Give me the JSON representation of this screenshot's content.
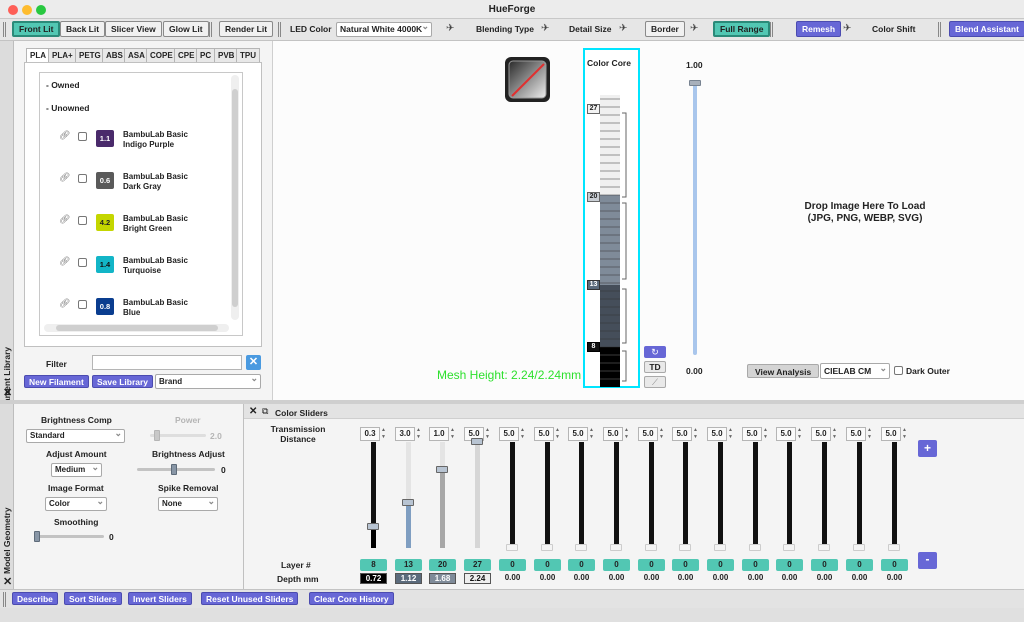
{
  "window": {
    "title": "HueForge"
  },
  "toolbar": {
    "front_lit": "Front Lit",
    "back_lit": "Back Lit",
    "slicer_view": "Slicer View",
    "glow_lit": "Glow Lit",
    "render_lit": "Render Lit",
    "led_color_label": "LED Color",
    "led_color_value": "Natural White 4000K",
    "blending_type": "Blending Type",
    "detail_size": "Detail Size",
    "border": "Border",
    "full_range": "Full Range",
    "remesh": "Remesh",
    "color_shift": "Color Shift",
    "blend_assistant": "Blend Assistant"
  },
  "library": {
    "side_label": "Filament Library",
    "tabs": [
      "PLA",
      "PLA+",
      "PETG",
      "ABS",
      "ASA",
      "COPE",
      "CPE",
      "PC",
      "PVB",
      "TPU"
    ],
    "owned": "- Owned",
    "unowned": "- Unowned",
    "filaments": [
      {
        "td": "1.1",
        "color": "#4a2a6b",
        "name": "BambuLab Basic",
        "variant": "Indigo Purple"
      },
      {
        "td": "0.6",
        "color": "#5a5a5a",
        "name": "BambuLab Basic",
        "variant": "Dark Gray"
      },
      {
        "td": "4.2",
        "color": "#c4d600",
        "name": "BambuLab Basic",
        "variant": "Bright Green"
      },
      {
        "td": "1.4",
        "color": "#12b5c7",
        "name": "BambuLab Basic",
        "variant": "Turquoise"
      },
      {
        "td": "0.8",
        "color": "#0a3d8f",
        "name": "BambuLab Basic",
        "variant": "Blue"
      }
    ],
    "filter_label": "Filter",
    "filter_value": "",
    "new_filament": "New Filament",
    "save_library": "Save Library",
    "sort_value": "Brand"
  },
  "viewer": {
    "color_core_title": "Color Core",
    "layer_markers": [
      "27",
      "20",
      "13",
      "8"
    ],
    "mesh_height": "Mesh Height: 2.24/2.24mm",
    "td_button": "TD",
    "scale_max": "1.00",
    "scale_min": "0.00",
    "drop_line1": "Drop Image Here To Load",
    "drop_line2": "(JPG, PNG, WEBP, SVG)",
    "view_analysis": "View Analysis",
    "analysis_mode": "CIELAB CM",
    "dark_outer": "Dark Outer"
  },
  "geometry": {
    "side_label": "Model Geometry",
    "brightness_comp": "Brightness Comp",
    "brightness_comp_value": "Standard",
    "power": "Power",
    "power_value": "2.0",
    "adjust_amount": "Adjust Amount",
    "adjust_amount_value": "Medium",
    "brightness_adjust": "Brightness Adjust",
    "brightness_adjust_value": "0",
    "image_format": "Image Format",
    "image_format_value": "Color",
    "spike_removal": "Spike Removal",
    "spike_removal_value": "None",
    "smoothing": "Smoothing",
    "smoothing_value": "0"
  },
  "sliders": {
    "title": "Color Sliders",
    "transmission_label1": "Transmission",
    "transmission_label2": "Distance",
    "layer_label": "Layer #",
    "depth_label": "Depth mm",
    "plus": "+",
    "minus": "-",
    "columns": [
      {
        "td": "0.3",
        "layer": "8",
        "depth": "0.72",
        "level": 0.2
      },
      {
        "td": "3.0",
        "layer": "13",
        "depth": "1.12",
        "level": 0.42
      },
      {
        "td": "1.0",
        "layer": "20",
        "depth": "1.68",
        "level": 0.74
      },
      {
        "td": "5.0",
        "layer": "27",
        "depth": "2.24",
        "level": 1.0
      },
      {
        "td": "5.0",
        "layer": "0",
        "depth": "0.00",
        "level": 0
      },
      {
        "td": "5.0",
        "layer": "0",
        "depth": "0.00",
        "level": 0
      },
      {
        "td": "5.0",
        "layer": "0",
        "depth": "0.00",
        "level": 0
      },
      {
        "td": "5.0",
        "layer": "0",
        "depth": "0.00",
        "level": 0
      },
      {
        "td": "5.0",
        "layer": "0",
        "depth": "0.00",
        "level": 0
      },
      {
        "td": "5.0",
        "layer": "0",
        "depth": "0.00",
        "level": 0
      },
      {
        "td": "5.0",
        "layer": "0",
        "depth": "0.00",
        "level": 0
      },
      {
        "td": "5.0",
        "layer": "0",
        "depth": "0.00",
        "level": 0
      },
      {
        "td": "5.0",
        "layer": "0",
        "depth": "0.00",
        "level": 0
      },
      {
        "td": "5.0",
        "layer": "0",
        "depth": "0.00",
        "level": 0
      },
      {
        "td": "5.0",
        "layer": "0",
        "depth": "0.00",
        "level": 0
      },
      {
        "td": "5.0",
        "layer": "0",
        "depth": "0.00",
        "level": 0
      }
    ]
  },
  "bottom": {
    "describe": "Describe",
    "sort_sliders": "Sort Sliders",
    "invert_sliders": "Invert Sliders",
    "reset_unused": "Reset Unused Sliders",
    "clear_core": "Clear Core History"
  }
}
